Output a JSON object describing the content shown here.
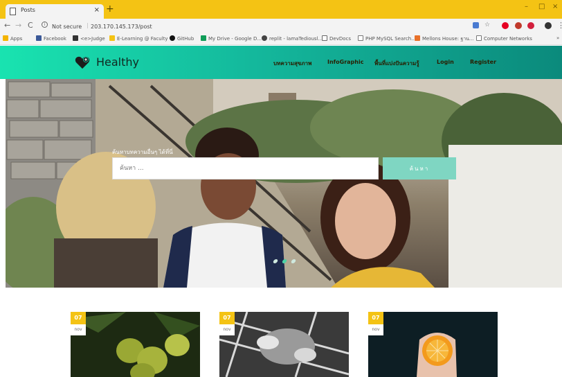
{
  "browser": {
    "tab_title": "Posts",
    "tab_close": "×",
    "new_tab": "+",
    "win_min": "–",
    "win_max": "□",
    "win_close": "×",
    "security": "Not secure",
    "url": "203.170.145.173/post"
  },
  "bookmarks": [
    {
      "label": "Apps",
      "color": "#f4b400"
    },
    {
      "label": "Facebook",
      "color": "#3b5998"
    },
    {
      "label": "<e>Judge",
      "color": "#333333"
    },
    {
      "label": "E-Learning @ Faculty",
      "color": "#f4c314"
    },
    {
      "label": "GitHub",
      "color": "#111111"
    },
    {
      "label": "My Drive - Google D...",
      "color": "#0f9d58"
    },
    {
      "label": "replit - lamaTediousl...",
      "color": "#444444"
    },
    {
      "label": "DevDocs",
      "color": "#666666"
    },
    {
      "label": "PHP MySQL Search...",
      "color": "#777777"
    },
    {
      "label": "Mellons House: ฐาน...",
      "color": "#e8712a"
    },
    {
      "label": "Computer Networks",
      "color": "#777777"
    }
  ],
  "site": {
    "brand": "Healthy",
    "brand_color": "#102820",
    "nav": [
      "บทความสุขภาพ",
      "InfoGraphic",
      "พื้นที่แบ่งปันความรู้",
      "Login",
      "Register"
    ]
  },
  "hero": {
    "search_label": "ค้นหาบทความอื่นๆ ได้ที่นี่",
    "search_placeholder": "ค้นหา ...",
    "search_button": "ค้นหา",
    "slide_count": 3,
    "active_slide": 1
  },
  "cards": [
    {
      "day": "07",
      "month": "nov",
      "image": "coconuts"
    },
    {
      "day": "07",
      "month": "nov",
      "image": "hot-water-bottle"
    },
    {
      "day": "07",
      "month": "nov",
      "image": "orange-in-hand"
    }
  ]
}
